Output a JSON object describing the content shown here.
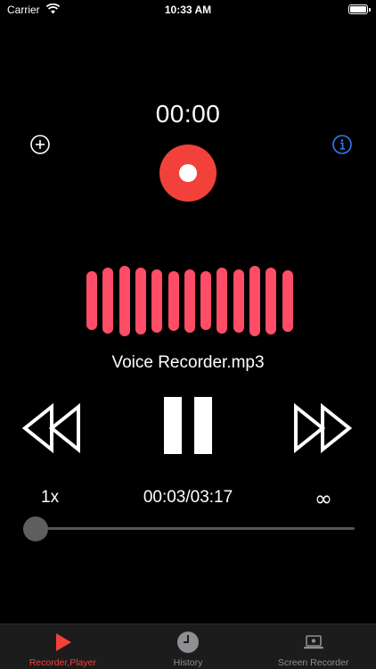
{
  "status_bar": {
    "carrier": "Carrier",
    "time": "10:33 AM"
  },
  "timer": "00:00",
  "waveform": {
    "color": "#ff4d67",
    "levels": [
      0.8,
      0.9,
      0.96,
      0.92,
      0.86,
      0.82,
      0.86,
      0.8,
      0.9,
      0.86,
      0.96,
      0.92,
      0.84
    ]
  },
  "player": {
    "file_name": "Voice Recorder.mp3",
    "speed": "1x",
    "progress_time": "00:03/03:17",
    "loop_symbol": "∞",
    "progress": 0.015
  },
  "colors": {
    "accent": "#f2413a",
    "info": "#2f7cf6"
  },
  "tabs": [
    {
      "label": "Recorder,Player",
      "icon": "play-icon",
      "active": true
    },
    {
      "label": "History",
      "icon": "clock-icon",
      "active": false
    },
    {
      "label": "Screen Recorder",
      "icon": "laptop-icon",
      "active": false
    }
  ]
}
